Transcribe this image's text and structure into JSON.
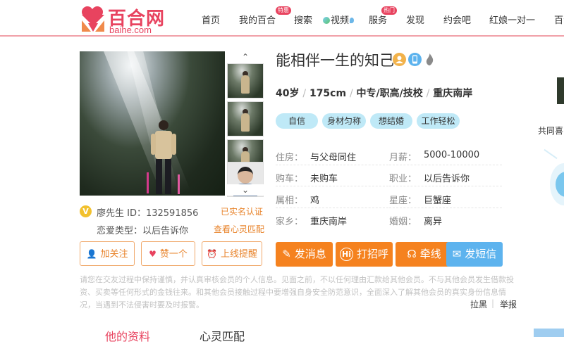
{
  "header": {
    "logo_cn": "百合网",
    "logo_en": "baihe.com",
    "nav": [
      {
        "label": "首页"
      },
      {
        "label": "我的百合",
        "badge": "特惠"
      },
      {
        "label": "搜索"
      },
      {
        "label": "视频"
      },
      {
        "label": "服务",
        "badge": "热门"
      },
      {
        "label": "发现"
      },
      {
        "label": "约会吧"
      },
      {
        "label": "红娘一对一"
      },
      {
        "label": "百合"
      }
    ]
  },
  "gallery": {
    "up_arrow": "⌃",
    "down_arrow": "⌄"
  },
  "profile": {
    "vip_mark": "V",
    "id_line": "廖先生 ID：132591856",
    "verified": "已实名认证",
    "love_type": "恋爱类型：以后告诉你",
    "match_link": "查看心灵匹配",
    "name": "能相伴一生的知己",
    "age": "40岁",
    "height": "175cm",
    "education": "中专/职高/技校",
    "location": "重庆南岸",
    "divider": "/",
    "tags": [
      "自信",
      "身材匀称",
      "想结婚",
      "工作轻松"
    ],
    "details": [
      {
        "label": "住房：",
        "value": "与父母同住"
      },
      {
        "label": "月薪：",
        "value": "5000-10000"
      },
      {
        "label": "购车：",
        "value": "未购车"
      },
      {
        "label": "职业：",
        "value": "以后告诉你"
      },
      {
        "label": "属相：",
        "value": "鸡"
      },
      {
        "label": "星座：",
        "value": "巨蟹座"
      },
      {
        "label": "家乡：",
        "value": "重庆南岸"
      },
      {
        "label": "婚姻：",
        "value": "离异"
      }
    ]
  },
  "actions_outline": [
    {
      "label": "加关注",
      "icon": "👤"
    },
    {
      "label": "赞一个",
      "icon": "♥"
    },
    {
      "label": "上线提醒",
      "icon": "⏰"
    }
  ],
  "actions_main": [
    {
      "label": "发消息",
      "icon": "✎",
      "color": "#f5821f"
    },
    {
      "label": "打招呼",
      "icon": "Hi",
      "color": "#f5821f"
    },
    {
      "label": "牵线",
      "icon": "☊",
      "color": "#f5821f"
    },
    {
      "label": "发短信",
      "icon": "✉",
      "color": "#5db3ee"
    }
  ],
  "notice": "请您在交友过程中保持谨慎，并认真审核会员的个人信息。见面之前，不以任何理由汇款给其他会员。不与其他会员发生借款投资、买卖等任何形式的金钱往来。和其他会员接触过程中要增强自身安全防范意识，全面深入了解其他会员的真实身份信息情况，当遇到不法侵害时要及时报警。",
  "report": {
    "block": "拉黑",
    "report": "举报",
    "sep": "|"
  },
  "tabs": [
    "他的资料",
    "心灵匹配"
  ],
  "side": {
    "text": "共同喜"
  }
}
